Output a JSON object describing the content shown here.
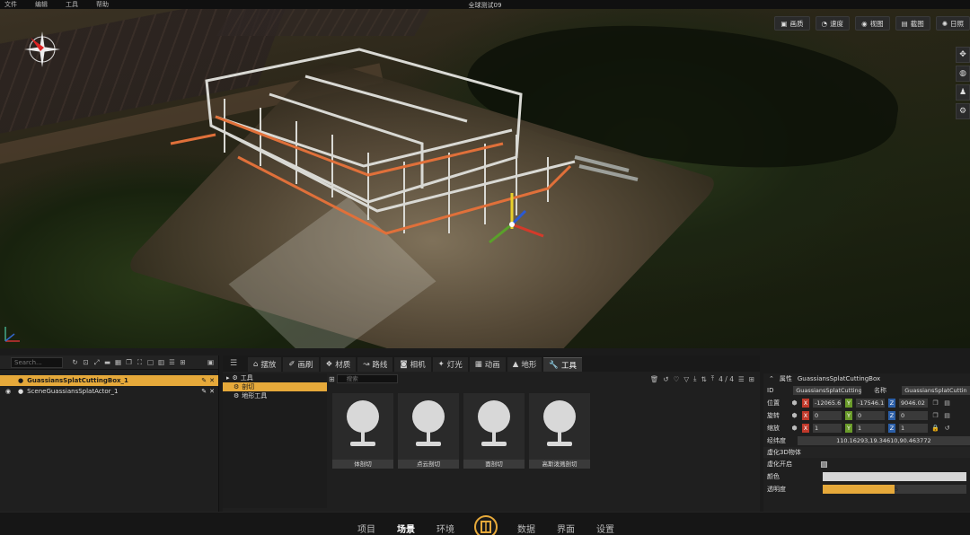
{
  "menubar": {
    "items": [
      "文件",
      "编辑",
      "工具",
      "帮助"
    ],
    "title": "全球测试09"
  },
  "viewport_toolbar": {
    "buttons": [
      {
        "label": "画质",
        "icon": "image-icon"
      },
      {
        "label": "速度",
        "icon": "speedometer-icon"
      },
      {
        "label": "视图",
        "icon": "eye-view-icon"
      },
      {
        "label": "截图",
        "icon": "screenshot-icon"
      },
      {
        "label": "日照",
        "icon": "sun-icon"
      }
    ]
  },
  "outliner": {
    "search_placeholder": "Search...",
    "items": [
      {
        "label": "GuassiansSplatCuttingBox_1",
        "selected": true
      },
      {
        "label": "SceneGuassiansSplatActor_1",
        "selected": false
      }
    ]
  },
  "tabs": [
    {
      "label": "摆放",
      "icon": "chair-icon"
    },
    {
      "label": "画刷",
      "icon": "brush-icon"
    },
    {
      "label": "材质",
      "icon": "material-icon"
    },
    {
      "label": "路线",
      "icon": "route-icon"
    },
    {
      "label": "相机",
      "icon": "camera-icon"
    },
    {
      "label": "灯光",
      "icon": "bulb-icon"
    },
    {
      "label": "动画",
      "icon": "film-icon"
    },
    {
      "label": "地形",
      "icon": "mountain-icon"
    },
    {
      "label": "工具",
      "icon": "wrench-icon",
      "active": true
    }
  ],
  "tree": {
    "root": "工具",
    "children": [
      {
        "label": "剖切",
        "selected": true
      },
      {
        "label": "地形工具",
        "selected": false
      }
    ]
  },
  "assets": {
    "search_placeholder": "搜索",
    "count": "4 / 4",
    "cards": [
      "体剖切",
      "点云剖切",
      "面剖切",
      "高斯泼溅剖切"
    ]
  },
  "properties": {
    "header": "属性",
    "object_name": "GuassiansSplatCuttingBox",
    "id_label": "ID",
    "id_value": "GuassiansSplatCutting",
    "name_label": "名称",
    "name_value": "GuassiansSplatCuttin",
    "position_label": "位置",
    "position": {
      "x": "-12065.6",
      "y": "-17546.1",
      "z": "9046.02"
    },
    "rotation_label": "旋转",
    "rotation": {
      "x": "0",
      "y": "0",
      "z": "0"
    },
    "scale_label": "缩放",
    "scale": {
      "x": "1",
      "y": "1",
      "z": "1"
    },
    "latlon_label": "经纬度",
    "latlon_value": "110.16293,19.34610,90.463772",
    "section_title": "虚化3D物体",
    "blur_label": "虚化开启",
    "color_label": "颜色",
    "opacity_label": "透明度",
    "opacity_value": "5",
    "opacity_fraction": 0.5
  },
  "navbar": {
    "items": [
      "项目",
      "场景",
      "环境",
      "数据",
      "界面",
      "设置"
    ],
    "active": "场景"
  },
  "colors": {
    "accent": "#e6a93a",
    "axis_x": "#c0392b",
    "axis_y": "#6a9b2a",
    "axis_z": "#2c5fa8"
  }
}
